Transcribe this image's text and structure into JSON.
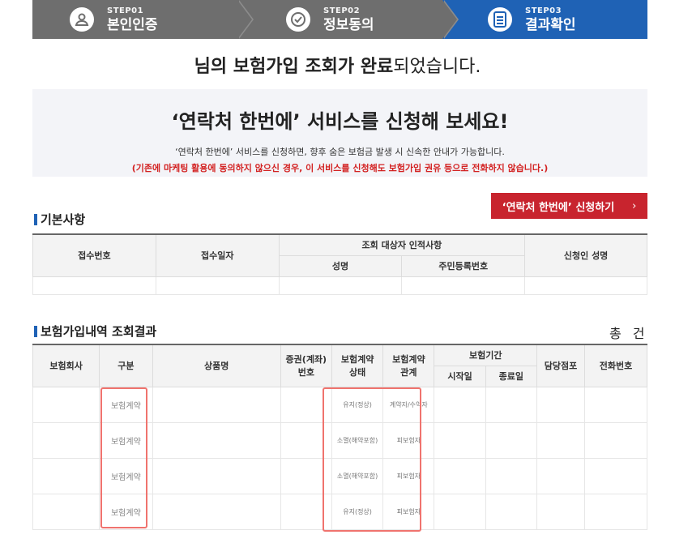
{
  "steps": [
    {
      "label": "STEP01",
      "name": "본인인증",
      "icon": "person-icon",
      "active": false
    },
    {
      "label": "STEP02",
      "name": "정보동의",
      "icon": "check-circle-icon",
      "active": false
    },
    {
      "label": "STEP03",
      "name": "결과확인",
      "icon": "document-icon",
      "active": true
    }
  ],
  "headline": {
    "suffix1": "님의 ",
    "bold": "보험가입 조회가 완료",
    "suffix2": "되었습니다."
  },
  "promo": {
    "title": "‘연락처 한번에’ 서비스를 신청해 보세요!",
    "desc": "‘연락처 한번에’ 서비스를 신청하면, 향후 숨은 보험금 발생 시 신속한 안내가 가능합니다.",
    "warning": "(기존에 마케팅 활용에 동의하지 않으신 경우, 이 서비스를 신청해도 보험가입 권유 등으로 전화하지 않습니다.)",
    "button": "‘연락처 한번에’ 신청하기",
    "button_arrow": "›"
  },
  "basic": {
    "title": "기본사항",
    "headers": {
      "receipt_no": "접수번호",
      "receipt_date": "접수일자",
      "target_group": "조회 대상자 인적사항",
      "name": "성명",
      "rrn": "주민등록번호",
      "applicant": "신청인 성명"
    }
  },
  "results": {
    "title": "보험가입내역 조회결과",
    "total_label": "총",
    "total_unit": "건",
    "headers": {
      "company": "보험회사",
      "kind": "구분",
      "product": "상품명",
      "policy_no_1": "증권(계좌)",
      "policy_no_2": "번호",
      "status_1": "보험계약",
      "status_2": "상태",
      "rel_1": "보험계약",
      "rel_2": "관계",
      "period": "보험기간",
      "start": "시작일",
      "end": "종료일",
      "branch": "담당점포",
      "phone": "전화번호"
    },
    "rows": [
      {
        "kind": "보험계약",
        "status": "유지(정상)",
        "relation": "계약자/수익자"
      },
      {
        "kind": "보험계약",
        "status": "소멸(해약포함)",
        "relation": "피보험자"
      },
      {
        "kind": "보험계약",
        "status": "소멸(해약포함)",
        "relation": "피보험자"
      },
      {
        "kind": "보험계약",
        "status": "유지(정상)",
        "relation": "피보험자"
      }
    ]
  },
  "colors": {
    "step_gray": "#6e6e6e",
    "step_active": "#1f62b5",
    "apply_red": "#c8242e",
    "warning_red": "#d32222",
    "highlight": "#f0736e"
  }
}
